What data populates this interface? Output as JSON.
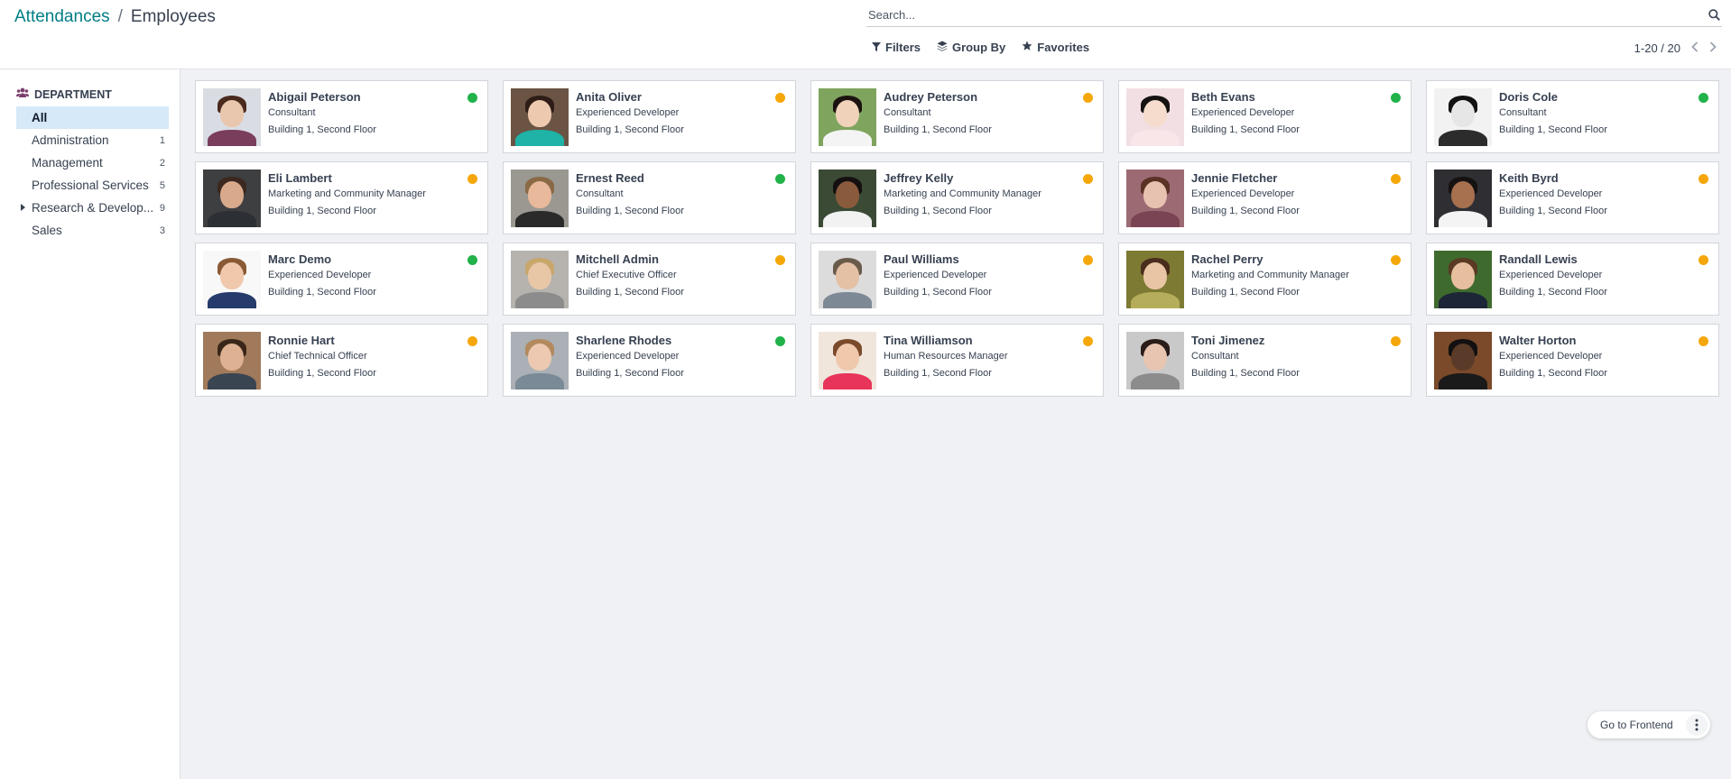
{
  "breadcrumb": {
    "parent": "Attendances",
    "separator": "/",
    "current": "Employees"
  },
  "search": {
    "placeholder": "Search..."
  },
  "toolbar": {
    "filters": "Filters",
    "group_by": "Group By",
    "favorites": "Favorites"
  },
  "pager": {
    "value": "1-20 / 20"
  },
  "sidebar": {
    "header": "DEPARTMENT",
    "items": [
      {
        "label": "All",
        "count": ""
      },
      {
        "label": "Administration",
        "count": "1"
      },
      {
        "label": "Management",
        "count": "2"
      },
      {
        "label": "Professional Services",
        "count": "5"
      },
      {
        "label": "Research & Develop...",
        "count": "9"
      },
      {
        "label": "Sales",
        "count": "3"
      }
    ]
  },
  "colors": {
    "present": "#21b24a",
    "absent": "#f5a70a",
    "accent": "#017e84"
  },
  "employees": [
    {
      "name": "Abigail Peterson",
      "job": "Consultant",
      "location": "Building 1, Second Floor",
      "status": "present",
      "skin": "#e9c7ae",
      "hair": "#4a2a1e",
      "shirt": "#7a3d5c",
      "bg": "#d9dde3"
    },
    {
      "name": "Anita Oliver",
      "job": "Experienced Developer",
      "location": "Building 1, Second Floor",
      "status": "absent",
      "skin": "#edc9b0",
      "hair": "#2e1d17",
      "shirt": "#1fb2a6",
      "bg": "#6b5443"
    },
    {
      "name": "Audrey Peterson",
      "job": "Consultant",
      "location": "Building 1, Second Floor",
      "status": "absent",
      "skin": "#f0d2bb",
      "hair": "#1b1310",
      "shirt": "#f4f4f4",
      "bg": "#7fa45e"
    },
    {
      "name": "Beth Evans",
      "job": "Experienced Developer",
      "location": "Building 1, Second Floor",
      "status": "present",
      "skin": "#f5dccd",
      "hair": "#161212",
      "shirt": "#f8e6e9",
      "bg": "#f2dfe3"
    },
    {
      "name": "Doris Cole",
      "job": "Consultant",
      "location": "Building 1, Second Floor",
      "status": "present",
      "skin": "#e6e6e6",
      "hair": "#121212",
      "shirt": "#2c2c2c",
      "bg": "#f2f2f2"
    },
    {
      "name": "Eli Lambert",
      "job": "Marketing and Community Manager",
      "location": "Building 1, Second Floor",
      "status": "absent",
      "skin": "#d9a98c",
      "hair": "#3b281f",
      "shirt": "#2c2f33",
      "bg": "#3d3f41"
    },
    {
      "name": "Ernest Reed",
      "job": "Consultant",
      "location": "Building 1, Second Floor",
      "status": "present",
      "skin": "#e8b99b",
      "hair": "#8a6a46",
      "shirt": "#2a2a2a",
      "bg": "#9a9891"
    },
    {
      "name": "Jeffrey Kelly",
      "job": "Marketing and Community Manager",
      "location": "Building 1, Second Floor",
      "status": "absent",
      "skin": "#8a5a3c",
      "hair": "#141010",
      "shirt": "#f2f2f2",
      "bg": "#3b4a35"
    },
    {
      "name": "Jennie Fletcher",
      "job": "Experienced Developer",
      "location": "Building 1, Second Floor",
      "status": "absent",
      "skin": "#e8c2b0",
      "hair": "#5a3226",
      "shirt": "#7a4454",
      "bg": "#9c6a73"
    },
    {
      "name": "Keith Byrd",
      "job": "Experienced Developer",
      "location": "Building 1, Second Floor",
      "status": "absent",
      "skin": "#a7704f",
      "hair": "#161212",
      "shirt": "#f4f4f4",
      "bg": "#2f2f33"
    },
    {
      "name": "Marc Demo",
      "job": "Experienced Developer",
      "location": "Building 1, Second Floor",
      "status": "present",
      "skin": "#f0c9ad",
      "hair": "#8a5a34",
      "shirt": "#263a6b",
      "bg": "#f8f8f8"
    },
    {
      "name": "Mitchell Admin",
      "job": "Chief Executive Officer",
      "location": "Building 1, Second Floor",
      "status": "absent",
      "skin": "#e8c7a7",
      "hair": "#c8a76b",
      "shirt": "#8c8c8c",
      "bg": "#b6b2ad"
    },
    {
      "name": "Paul Williams",
      "job": "Experienced Developer",
      "location": "Building 1, Second Floor",
      "status": "absent",
      "skin": "#e4c0a5",
      "hair": "#6a5a4a",
      "shirt": "#7d8a96",
      "bg": "#dcdcdc"
    },
    {
      "name": "Rachel Perry",
      "job": "Marketing and Community Manager",
      "location": "Building 1, Second Floor",
      "status": "absent",
      "skin": "#e9c5a5",
      "hair": "#4a2d1c",
      "shirt": "#b6ad5c",
      "bg": "#7d7a33"
    },
    {
      "name": "Randall Lewis",
      "job": "Experienced Developer",
      "location": "Building 1, Second Floor",
      "status": "absent",
      "skin": "#e7be9e",
      "hair": "#5a3a22",
      "shirt": "#1c2636",
      "bg": "#3f6a2e"
    },
    {
      "name": "Ronnie Hart",
      "job": "Chief Technical Officer",
      "location": "Building 1, Second Floor",
      "status": "absent",
      "skin": "#deb193",
      "hair": "#3a2618",
      "shirt": "#3a4552",
      "bg": "#a07a5a"
    },
    {
      "name": "Sharlene Rhodes",
      "job": "Experienced Developer",
      "location": "Building 1, Second Floor",
      "status": "present",
      "skin": "#ecc9b0",
      "hair": "#b38a5e",
      "shirt": "#7a8a96",
      "bg": "#aab0b6"
    },
    {
      "name": "Tina Williamson",
      "job": "Human Resources Manager",
      "location": "Building 1, Second Floor",
      "status": "absent",
      "skin": "#f0c9ad",
      "hair": "#7a4a2a",
      "shirt": "#e8345a",
      "bg": "#f0e6dc"
    },
    {
      "name": "Toni Jimenez",
      "job": "Consultant",
      "location": "Building 1, Second Floor",
      "status": "absent",
      "skin": "#e8c5b0",
      "hair": "#2a1c18",
      "shirt": "#8c8c8c",
      "bg": "#c9c9c9"
    },
    {
      "name": "Walter Horton",
      "job": "Experienced Developer",
      "location": "Building 1, Second Floor",
      "status": "absent",
      "skin": "#5a3a28",
      "hair": "#121010",
      "shirt": "#1a1a1a",
      "bg": "#7a4a2a"
    }
  ],
  "floating": {
    "frontend_label": "Go to Frontend"
  }
}
